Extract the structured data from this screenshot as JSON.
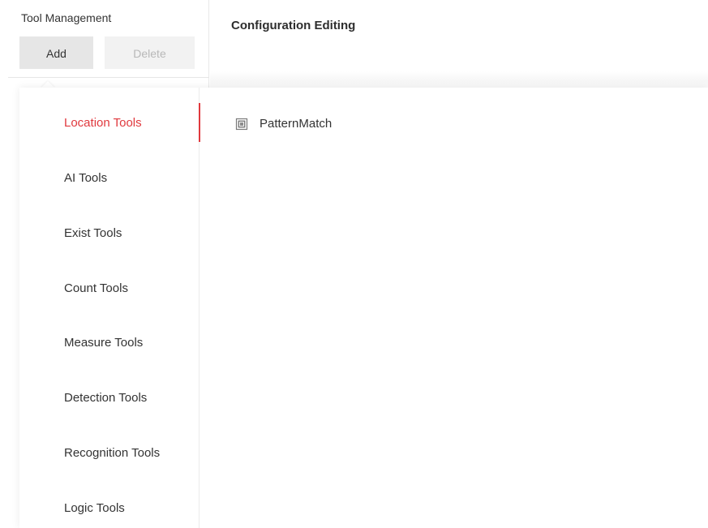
{
  "tool_management": {
    "title": "Tool Management",
    "add_label": "Add",
    "delete_label": "Delete"
  },
  "config": {
    "title": "Configuration Editing"
  },
  "categories": [
    {
      "label": "Location Tools",
      "active": true
    },
    {
      "label": "AI Tools",
      "active": false
    },
    {
      "label": "Exist Tools",
      "active": false
    },
    {
      "label": "Count Tools",
      "active": false
    },
    {
      "label": "Measure Tools",
      "active": false
    },
    {
      "label": "Detection Tools",
      "active": false
    },
    {
      "label": "Recognition Tools",
      "active": false
    },
    {
      "label": "Logic Tools",
      "active": false
    }
  ],
  "tools": [
    {
      "label": "PatternMatch",
      "icon": "pattern-match-icon"
    }
  ],
  "colors": {
    "accent": "#e0393e",
    "text": "#333333",
    "disabled_text": "#b8b8b8",
    "button_bg": "#e6e6e6"
  }
}
